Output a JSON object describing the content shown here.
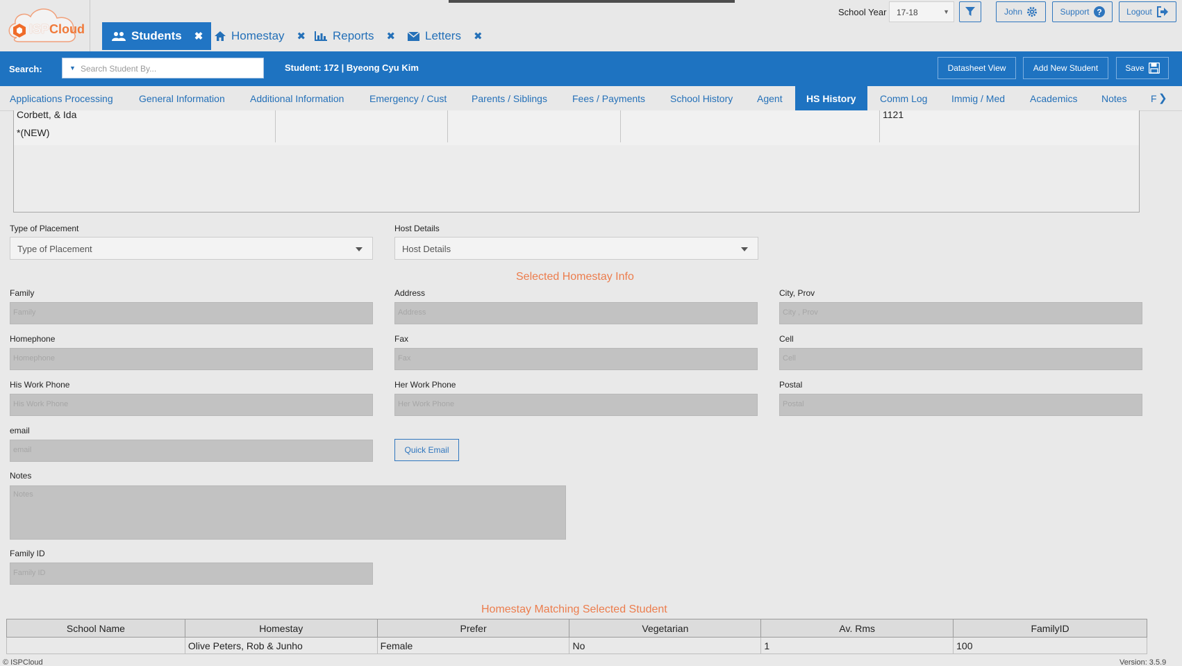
{
  "app": {
    "logo_isp": "ISP",
    "logo_cloud": "Cloud",
    "brand_color": "#ec7d4d",
    "accent_color": "#1e73c1"
  },
  "main_tabs": [
    {
      "label": "Students",
      "icon": "users-icon",
      "active": true
    },
    {
      "label": "Homestay",
      "icon": "home-icon",
      "active": false
    },
    {
      "label": "Reports",
      "icon": "bar-chart-icon",
      "active": false
    },
    {
      "label": "Letters",
      "icon": "envelope-icon",
      "active": false
    }
  ],
  "top_right": {
    "school_year_label": "School Year",
    "school_year_value": "17-18",
    "user_label": "John",
    "support_label": "Support",
    "logout_label": "Logout"
  },
  "bluebar": {
    "search_label": "Search:",
    "search_placeholder": "Search Student By...",
    "student_info": "Student: 172 | Byeong Cyu Kim",
    "datasheet_label": "Datasheet View",
    "add_new_label": "Add New Student",
    "save_label": "Save"
  },
  "sub_tabs": [
    "Applications Processing",
    "General Information",
    "Additional Information",
    "Emergency / Cust",
    "Parents / Siblings",
    "Fees / Payments",
    "School History",
    "Agent",
    "HS History",
    "Comm Log",
    "Immig / Med",
    "Academics",
    "Notes",
    "F"
  ],
  "history_grid": {
    "row1": {
      "name": "Corbett, & Ida",
      "id": "1121"
    },
    "row2": {
      "name": "*(NEW)"
    }
  },
  "placement": {
    "type_label": "Type of Placement",
    "type_value": "Type of Placement",
    "host_label": "Host Details",
    "host_value": "Host Details"
  },
  "selected_title": "Selected Homestay Info",
  "fields": {
    "family": {
      "label": "Family",
      "placeholder": "Family"
    },
    "address": {
      "label": "Address",
      "placeholder": "Address"
    },
    "city": {
      "label": "City, Prov",
      "placeholder": "City , Prov"
    },
    "homephone": {
      "label": "Homephone",
      "placeholder": "Homephone"
    },
    "fax": {
      "label": "Fax",
      "placeholder": "Fax"
    },
    "cell": {
      "label": "Cell",
      "placeholder": "Cell"
    },
    "his_work": {
      "label": "His Work Phone",
      "placeholder": "His Work Phone"
    },
    "her_work": {
      "label": "Her Work Phone",
      "placeholder": "Her Work Phone"
    },
    "postal": {
      "label": "Postal",
      "placeholder": "Postal"
    },
    "email": {
      "label": "email",
      "placeholder": "email"
    },
    "notes": {
      "label": "Notes",
      "placeholder": "Notes"
    },
    "family_id": {
      "label": "Family ID",
      "placeholder": "Family ID"
    }
  },
  "quick_email_label": "Quick Email",
  "matching": {
    "title": "Homestay Matching Selected Student",
    "headers": [
      "School Name",
      "Homestay",
      "Prefer",
      "Vegetarian",
      "Av. Rms",
      "FamilyID"
    ],
    "rows": [
      [
        "",
        "Olive Peters, Rob & Junho",
        "Female",
        "No",
        "1",
        "100"
      ]
    ]
  },
  "footer": {
    "copyright": "© ISPCloud",
    "version": "Version: 3.5.9"
  }
}
